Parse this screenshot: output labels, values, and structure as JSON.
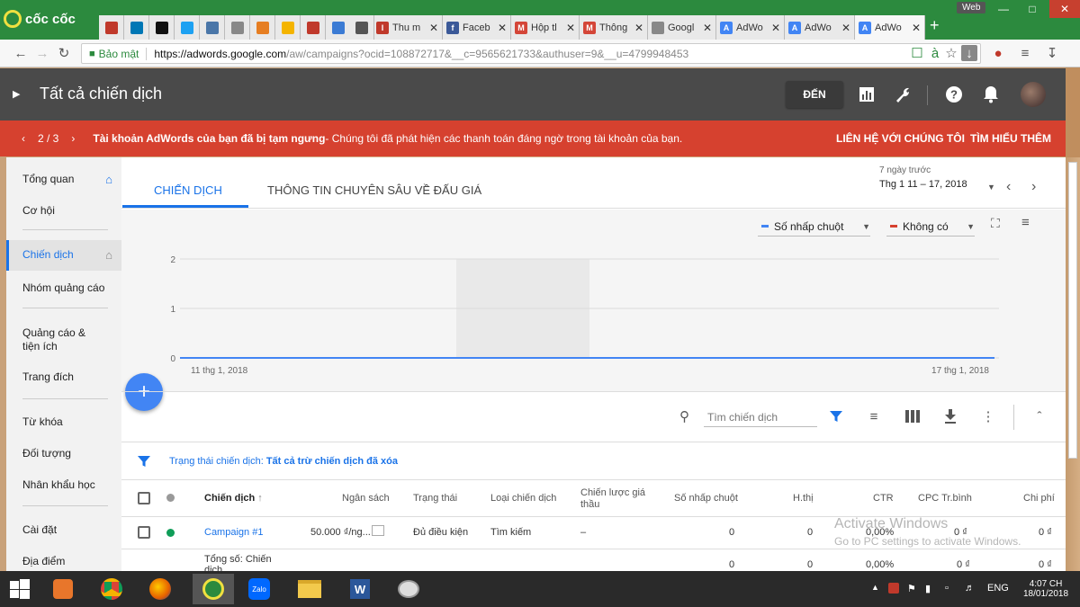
{
  "browser": {
    "brand": "cốc cốc",
    "web_badge": "Web",
    "tabs": [
      {
        "label": "Thu m",
        "fav": "IDV",
        "color": "#c0392b"
      },
      {
        "label": "Faceb",
        "fav": "f",
        "color": "#3b5998"
      },
      {
        "label": "Hộp tl",
        "fav": "M",
        "color": "#d44638"
      },
      {
        "label": "Thông",
        "fav": "M",
        "color": "#d44638"
      },
      {
        "label": "Googl",
        "fav": "doc",
        "color": "#888888"
      },
      {
        "label": "AdWo",
        "fav": "A",
        "color": "#4285f4"
      },
      {
        "label": "AdWo",
        "fav": "A",
        "color": "#4285f4"
      },
      {
        "label": "AdWo",
        "fav": "A",
        "color": "#4285f4"
      }
    ],
    "secure_label": "Bảo mật",
    "url_host": "https://adwords.google.com",
    "url_path": "/aw/campaigns?ocid=108872717&__c=9565621733&authuser=9&__u=4799948453"
  },
  "header": {
    "title": "Tất cả chiến dịch",
    "goto_label": "ĐẾN"
  },
  "alert": {
    "pager": "2 / 3",
    "bold_text": "Tài khoản AdWords của bạn đã bị tạm ngưng",
    "text": " - Chúng tôi đã phát hiện các thanh toán đáng ngờ trong tài khoản của bạn.",
    "contact": "LIÊN HỆ VỚI CHÚNG TÔI",
    "learn_more": "TÌM HIỂU THÊM"
  },
  "sidebar": {
    "items": [
      {
        "label": "Tổng quan"
      },
      {
        "label": "Cơ hội"
      },
      {
        "label": "Chiến dịch"
      },
      {
        "label": "Nhóm quảng cáo"
      },
      {
        "label": "Quảng cáo & tiện ích"
      },
      {
        "label": "Trang đích"
      },
      {
        "label": "Từ khóa"
      },
      {
        "label": "Đối tượng"
      },
      {
        "label": "Nhân khẩu học"
      },
      {
        "label": "Cài đặt"
      },
      {
        "label": "Địa điểm"
      }
    ]
  },
  "main": {
    "tabs": [
      {
        "label": "CHIẾN DỊCH"
      },
      {
        "label": "THÔNG TIN CHUYÊN SÂU VỀ ĐẤU GIÁ"
      }
    ],
    "date_caption": "7 ngày trước",
    "date_range": "Thg 1 11 – 17, 2018",
    "metric1": "Số nhấp chuột",
    "metric2": "Không có",
    "search_placeholder": "Tìm chiến dịch",
    "filter_label": "Trạng thái chiến dịch:",
    "filter_value": "Tất cả trừ chiến dịch đã xóa",
    "columns": [
      "Chiến dịch",
      "Ngân sách",
      "Trạng thái",
      "Loại chiến dịch",
      "Chiến lược giá thầu",
      "Số nhấp chuột",
      "H.thị",
      "CTR",
      "CPC Tr.bình",
      "Chi phí"
    ],
    "rows": [
      {
        "name": "Campaign #1",
        "budget": "50.000 ₫/ng...",
        "status": "Đủ điều kiện",
        "type": "Tìm kiếm",
        "bid": "–",
        "clicks": "0",
        "impr": "0",
        "ctr": "0,00%",
        "cpc": "0 ₫",
        "cost": "0 ₫"
      }
    ],
    "total": {
      "label": "Tổng số: Chiến dịch",
      "clicks": "0",
      "impr": "0",
      "ctr": "0,00%",
      "cpc": "0 ₫",
      "cost": "0 ₫"
    }
  },
  "chart_data": {
    "type": "line",
    "x": [
      "11 thg 1, 2018",
      "17 thg 1, 2018"
    ],
    "series": [
      {
        "name": "Số nhấp chuột",
        "values": [
          0,
          0,
          0,
          0,
          0,
          0,
          0
        ]
      }
    ],
    "yticks": [
      "0",
      "1",
      "2"
    ],
    "ylim": [
      0,
      2
    ],
    "grid": true
  },
  "watermark": {
    "line1": "Activate Windows",
    "line2": "Go to PC settings to activate Windows."
  },
  "taskbar": {
    "lang": "ENG",
    "time": "4:07 CH",
    "date": "18/01/2018"
  }
}
